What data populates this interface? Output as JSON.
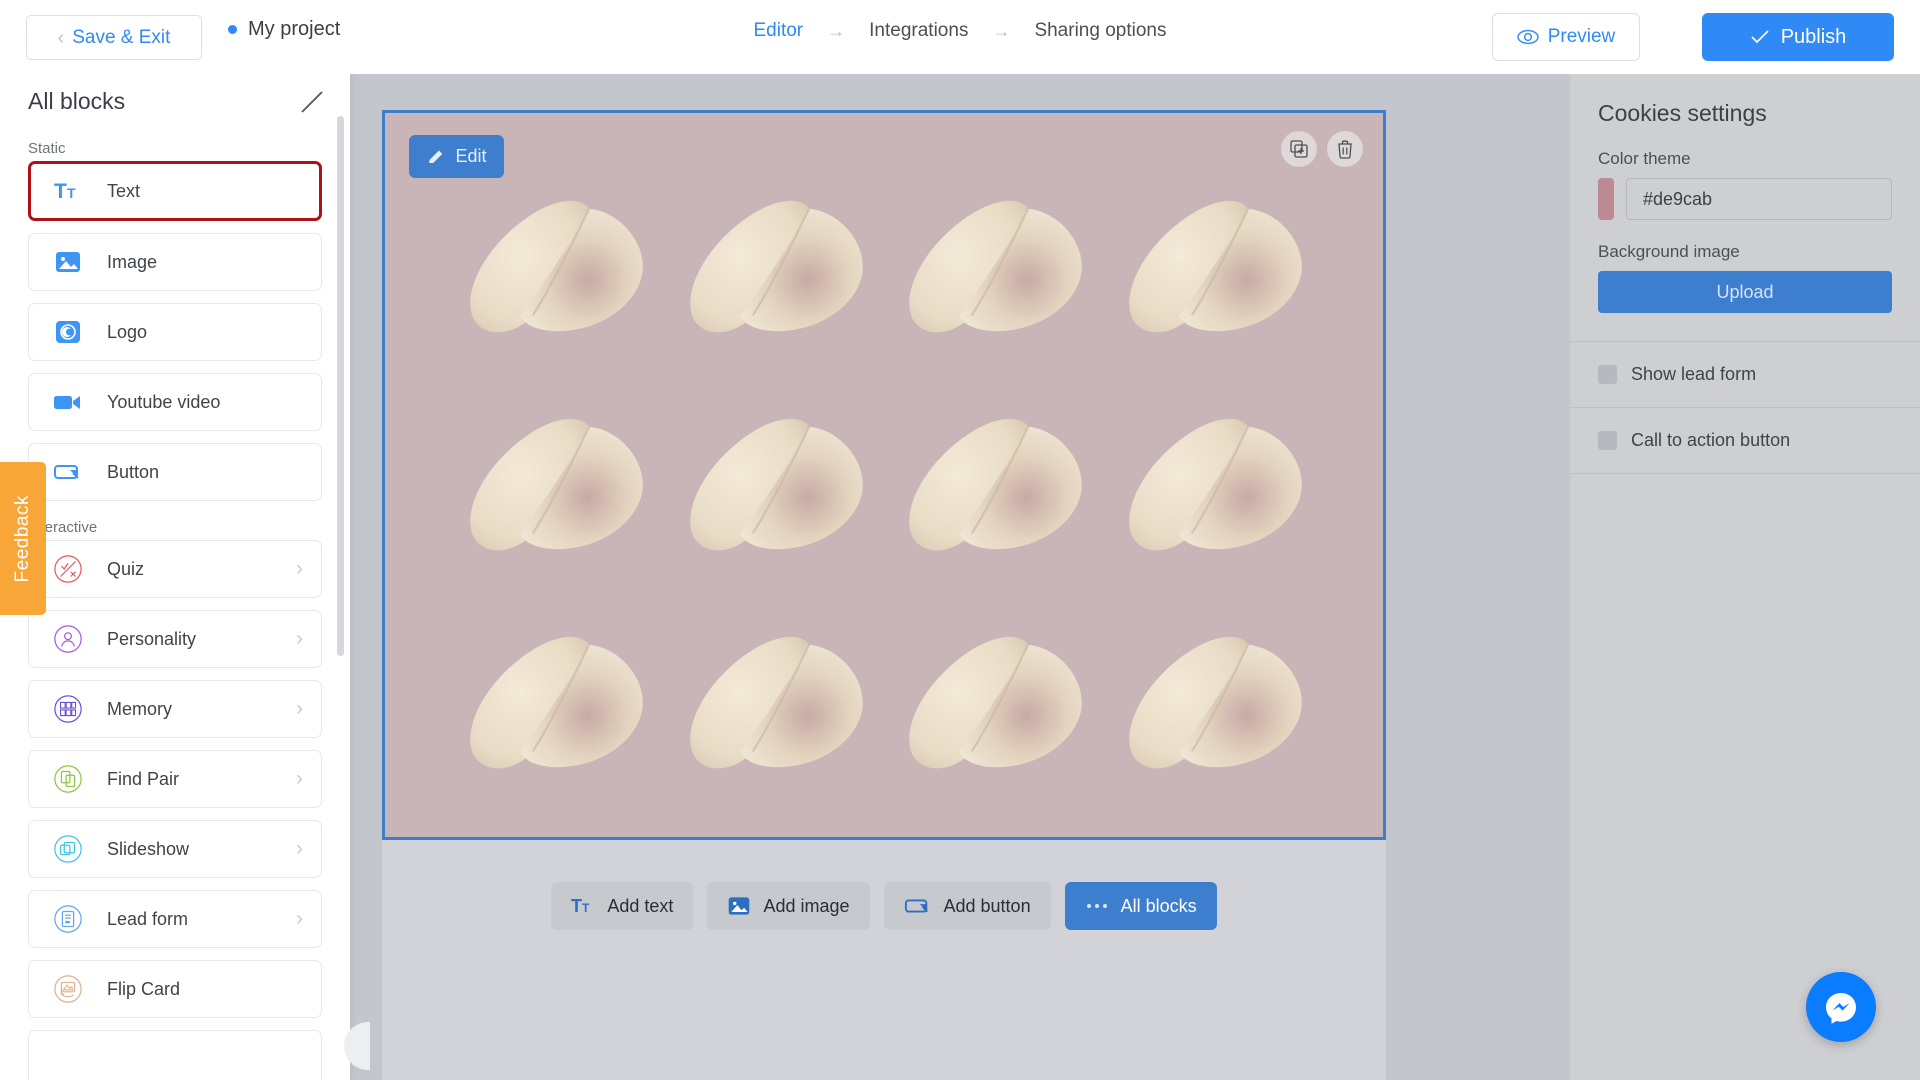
{
  "topbar": {
    "save_exit_label": "Save & Exit",
    "back_chevron_icon": "chevron-left-icon",
    "project_name": "My project",
    "status_dot_color": "#2f8af5",
    "breadcrumb": [
      {
        "label": "Editor",
        "active": true
      },
      {
        "label": "Integrations",
        "active": false
      },
      {
        "label": "Sharing options",
        "active": false
      }
    ],
    "breadcrumb_separator": "→",
    "preview_label": "Preview",
    "preview_icon": "eye-icon",
    "publish_label": "Publish",
    "publish_icon": "check-icon",
    "publish_color": "#2f8af5"
  },
  "left_panel": {
    "title": "All blocks",
    "close_icon": "close-icon",
    "sections": [
      {
        "label": "Static",
        "items": [
          {
            "label": "Text",
            "icon": "text-format-icon",
            "highlighted": true,
            "has_chevron": false
          },
          {
            "label": "Image",
            "icon": "image-icon",
            "highlighted": false,
            "has_chevron": false
          },
          {
            "label": "Logo",
            "icon": "logo-icon",
            "highlighted": false,
            "has_chevron": false
          },
          {
            "label": "Youtube video",
            "icon": "video-camera-icon",
            "highlighted": false,
            "has_chevron": false
          },
          {
            "label": "Button",
            "icon": "button-icon",
            "highlighted": false,
            "has_chevron": false
          }
        ]
      },
      {
        "label": "Interactive",
        "items": [
          {
            "label": "Quiz",
            "icon": "quiz-icon",
            "highlighted": false,
            "has_chevron": true
          },
          {
            "label": "Personality",
            "icon": "personality-icon",
            "highlighted": false,
            "has_chevron": true
          },
          {
            "label": "Memory",
            "icon": "memory-grid-icon",
            "highlighted": false,
            "has_chevron": true
          },
          {
            "label": "Find Pair",
            "icon": "find-pair-icon",
            "highlighted": false,
            "has_chevron": true
          },
          {
            "label": "Slideshow",
            "icon": "slideshow-icon",
            "highlighted": false,
            "has_chevron": true
          },
          {
            "label": "Lead form",
            "icon": "lead-form-icon",
            "highlighted": false,
            "has_chevron": true
          },
          {
            "label": "Flip Card",
            "icon": "flip-card-icon",
            "highlighted": false,
            "has_chevron": false
          }
        ]
      }
    ],
    "highlight_color": "#b01116"
  },
  "feedback_tab": {
    "label": "Feedback",
    "color": "#f7a637"
  },
  "canvas": {
    "edit_label": "Edit",
    "edit_icon": "pencil-icon",
    "block_background_color": "#c9b5b7",
    "selection_border_color": "#3d7fce",
    "tools": [
      {
        "name": "duplicate-icon"
      },
      {
        "name": "delete-icon"
      }
    ],
    "cookie_count": 12
  },
  "bottom_toolbar": {
    "buttons": [
      {
        "label": "Add text",
        "icon": "text-format-icon",
        "primary": false
      },
      {
        "label": "Add image",
        "icon": "image-icon",
        "primary": false
      },
      {
        "label": "Add button",
        "icon": "button-icon",
        "primary": false
      },
      {
        "label": "All blocks",
        "icon": "ellipsis-icon",
        "primary": true
      }
    ]
  },
  "right_panel": {
    "title": "Cookies settings",
    "color_theme_label": "Color theme",
    "color_theme_value": "#de9cab",
    "color_swatch_color": "#bb8a93",
    "background_image_label": "Background image",
    "upload_label": "Upload",
    "upload_color": "#3d7fce",
    "toggles": [
      {
        "label": "Show lead form",
        "checked": false
      },
      {
        "label": "Call to action button",
        "checked": false
      }
    ]
  },
  "messenger": {
    "icon": "messenger-icon",
    "color": "#0a7cff"
  }
}
